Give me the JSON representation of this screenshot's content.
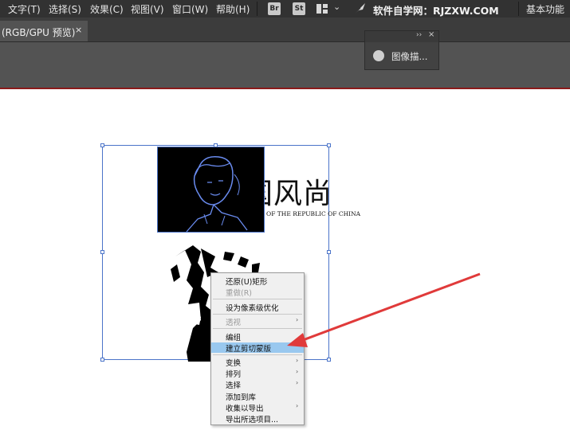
{
  "menubar": {
    "items": [
      "文字(T)",
      "选择(S)",
      "效果(C)",
      "视图(V)",
      "窗口(W)",
      "帮助(H)"
    ],
    "app_icons": [
      "Br",
      "St"
    ],
    "layout_icon": "layout-grid-icon",
    "dropdown_icon": "chevron-down-icon",
    "feather_icon": "feather-icon",
    "brand_text": "软件自学网：RJZXW.COM",
    "workspace": "基本功能"
  },
  "tab": {
    "label": "(RGB/GPU 预览)",
    "close": "×"
  },
  "float_panel": {
    "collapse": "››",
    "close": "×",
    "label": "图像描..."
  },
  "artboard": {
    "headline": "国风尚",
    "subline": "ION OF THE REPUBLIC OF CHINA"
  },
  "context_menu": {
    "items": [
      {
        "label": "还原(U)矩形",
        "submenu": false,
        "disabled": false,
        "active": false
      },
      {
        "label": "重做(R)",
        "submenu": false,
        "disabled": true,
        "active": false
      },
      {
        "label": "设为像素级优化",
        "submenu": false,
        "disabled": false,
        "active": false
      },
      {
        "label": "透视",
        "submenu": true,
        "disabled": true,
        "active": false
      },
      {
        "label": "编组",
        "submenu": false,
        "disabled": false,
        "active": false
      },
      {
        "label": "建立剪切蒙版",
        "submenu": false,
        "disabled": false,
        "active": true
      },
      {
        "label": "变换",
        "submenu": true,
        "disabled": false,
        "active": false
      },
      {
        "label": "排列",
        "submenu": true,
        "disabled": false,
        "active": false
      },
      {
        "label": "选择",
        "submenu": true,
        "disabled": false,
        "active": false
      },
      {
        "label": "添加到库",
        "submenu": false,
        "disabled": false,
        "active": false
      },
      {
        "label": "收集以导出",
        "submenu": true,
        "disabled": false,
        "active": false
      },
      {
        "label": "导出所选项目...",
        "submenu": false,
        "disabled": false,
        "active": false
      }
    ],
    "submenu_glyph": "›"
  },
  "colors": {
    "menubar_bg": "#323232",
    "panel_bg": "#535353",
    "selection_blue": "#4b74c9",
    "highlight": "#99c8ef",
    "annotation_arrow": "#e03a3a"
  }
}
